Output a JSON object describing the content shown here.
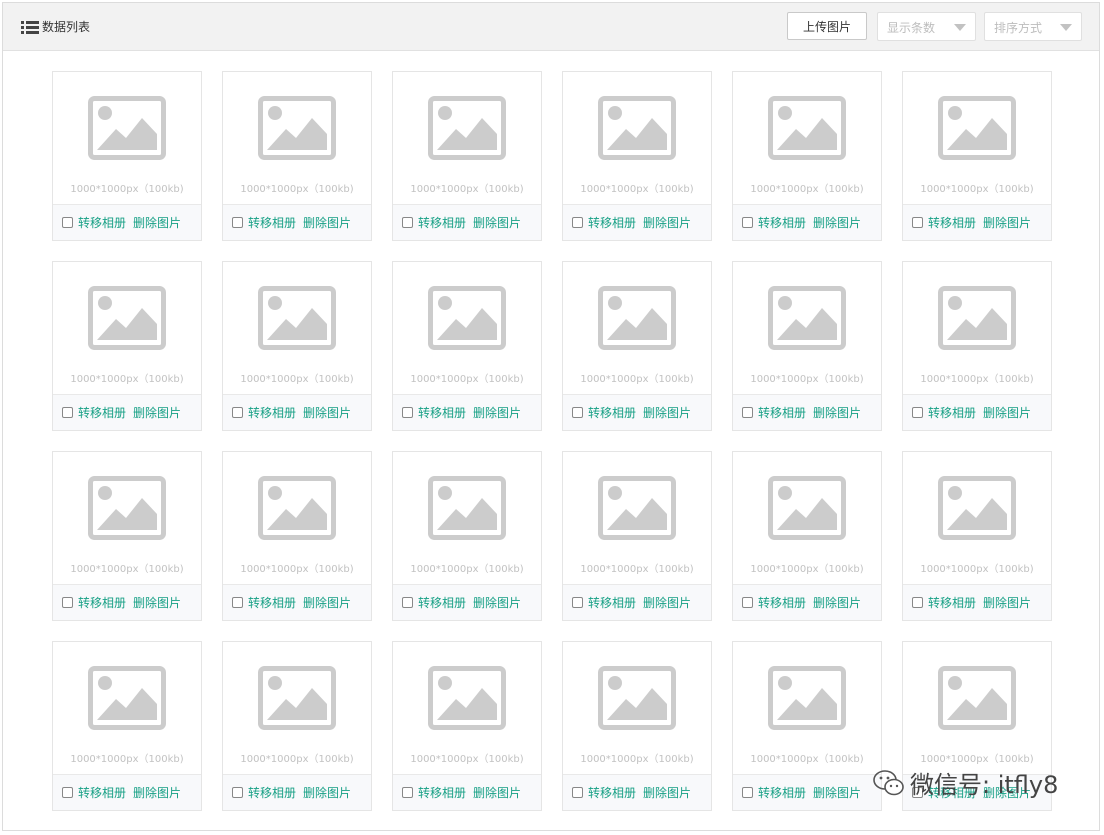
{
  "header": {
    "title": "数据列表",
    "upload_label": "上传图片",
    "page_size_placeholder": "显示条数",
    "sort_placeholder": "排序方式"
  },
  "cards": [
    {
      "size": "1000*1000px（100kb)",
      "move": "转移相册",
      "delete": "删除图片"
    },
    {
      "size": "1000*1000px（100kb)",
      "move": "转移相册",
      "delete": "删除图片"
    },
    {
      "size": "1000*1000px（100kb)",
      "move": "转移相册",
      "delete": "删除图片"
    },
    {
      "size": "1000*1000px（100kb)",
      "move": "转移相册",
      "delete": "删除图片"
    },
    {
      "size": "1000*1000px（100kb)",
      "move": "转移相册",
      "delete": "删除图片"
    },
    {
      "size": "1000*1000px（100kb)",
      "move": "转移相册",
      "delete": "删除图片"
    },
    {
      "size": "1000*1000px（100kb)",
      "move": "转移相册",
      "delete": "删除图片"
    },
    {
      "size": "1000*1000px（100kb)",
      "move": "转移相册",
      "delete": "删除图片"
    },
    {
      "size": "1000*1000px（100kb)",
      "move": "转移相册",
      "delete": "删除图片"
    },
    {
      "size": "1000*1000px（100kb)",
      "move": "转移相册",
      "delete": "删除图片"
    },
    {
      "size": "1000*1000px（100kb)",
      "move": "转移相册",
      "delete": "删除图片"
    },
    {
      "size": "1000*1000px（100kb)",
      "move": "转移相册",
      "delete": "删除图片"
    },
    {
      "size": "1000*1000px（100kb)",
      "move": "转移相册",
      "delete": "删除图片"
    },
    {
      "size": "1000*1000px（100kb)",
      "move": "转移相册",
      "delete": "删除图片"
    },
    {
      "size": "1000*1000px（100kb)",
      "move": "转移相册",
      "delete": "删除图片"
    },
    {
      "size": "1000*1000px（100kb)",
      "move": "转移相册",
      "delete": "删除图片"
    },
    {
      "size": "1000*1000px（100kb)",
      "move": "转移相册",
      "delete": "删除图片"
    },
    {
      "size": "1000*1000px（100kb)",
      "move": "转移相册",
      "delete": "删除图片"
    },
    {
      "size": "1000*1000px（100kb)",
      "move": "转移相册",
      "delete": "删除图片"
    },
    {
      "size": "1000*1000px（100kb)",
      "move": "转移相册",
      "delete": "删除图片"
    },
    {
      "size": "1000*1000px（100kb)",
      "move": "转移相册",
      "delete": "删除图片"
    },
    {
      "size": "1000*1000px（100kb)",
      "move": "转移相册",
      "delete": "删除图片"
    },
    {
      "size": "1000*1000px（100kb)",
      "move": "转移相册",
      "delete": "删除图片"
    },
    {
      "size": "1000*1000px（100kb)",
      "move": "转移相册",
      "delete": "删除图片"
    }
  ],
  "watermark": {
    "text": "微信号: itfly8",
    "icon": "wechat-icon"
  },
  "colors": {
    "action": "#16a085",
    "placeholder_icon": "#cccccc",
    "header_bg": "#f2f2f2"
  },
  "icons": {
    "title": "list-icon",
    "thumbnail": "image-placeholder-icon",
    "select": "caret-down-icon"
  }
}
